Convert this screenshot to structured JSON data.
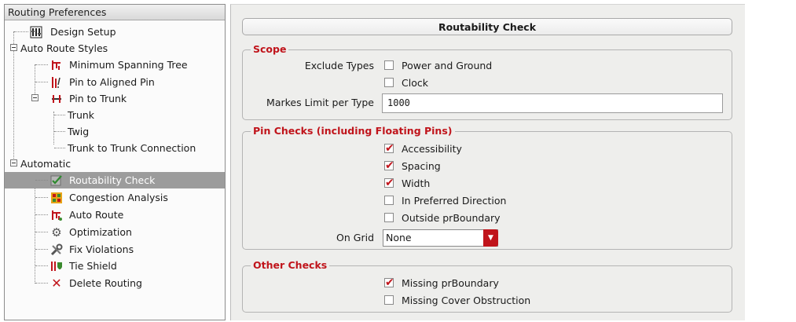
{
  "tree": {
    "header": "Routing Preferences",
    "items": [
      {
        "label": "Design Setup",
        "icon": "design-setup-icon"
      },
      {
        "label": "Auto Route Styles",
        "icon": ""
      },
      {
        "label": "Minimum Spanning Tree",
        "icon": "spanning-tree-icon"
      },
      {
        "label": "Pin to Aligned Pin",
        "icon": "aligned-pin-icon"
      },
      {
        "label": "Pin to Trunk",
        "icon": "pin-trunk-icon"
      },
      {
        "label": "Trunk",
        "icon": ""
      },
      {
        "label": "Twig",
        "icon": ""
      },
      {
        "label": "Trunk to Trunk Connection",
        "icon": ""
      },
      {
        "label": "Automatic",
        "icon": ""
      },
      {
        "label": "Routability Check",
        "icon": "check-icon"
      },
      {
        "label": "Congestion Analysis",
        "icon": "congestion-icon"
      },
      {
        "label": "Auto Route",
        "icon": "auto-route-icon"
      },
      {
        "label": "Optimization",
        "icon": "gear-icon"
      },
      {
        "label": "Fix Violations",
        "icon": "wrench-icon"
      },
      {
        "label": "Tie Shield",
        "icon": "tie-shield-icon"
      },
      {
        "label": "Delete Routing",
        "icon": "delete-icon"
      }
    ]
  },
  "panel": {
    "title": "Routability Check",
    "scope": {
      "title": "Scope",
      "exclude_label": "Exclude Types",
      "power_ground": {
        "label": "Power and Ground",
        "checked": false
      },
      "clock": {
        "label": "Clock",
        "checked": false
      },
      "marks_label": "Markes Limit per Type",
      "marks_value": "1000"
    },
    "pin_checks": {
      "title": "Pin Checks (including Floating Pins)",
      "accessibility": {
        "label": "Accessibility",
        "checked": true
      },
      "spacing": {
        "label": "Spacing",
        "checked": true
      },
      "width": {
        "label": "Width",
        "checked": true
      },
      "preferred": {
        "label": "In Preferred Direction",
        "checked": false
      },
      "outside": {
        "label": "Outside prBoundary",
        "checked": false
      },
      "on_grid_label": "On Grid",
      "on_grid_value": "None"
    },
    "other_checks": {
      "title": "Other Checks",
      "missing_boundary": {
        "label": "Missing prBoundary",
        "checked": true
      },
      "missing_cover": {
        "label": "Missing Cover Obstruction",
        "checked": false
      }
    }
  },
  "colors": {
    "accent": "#c0141b",
    "selection": "#9c9c9c"
  }
}
